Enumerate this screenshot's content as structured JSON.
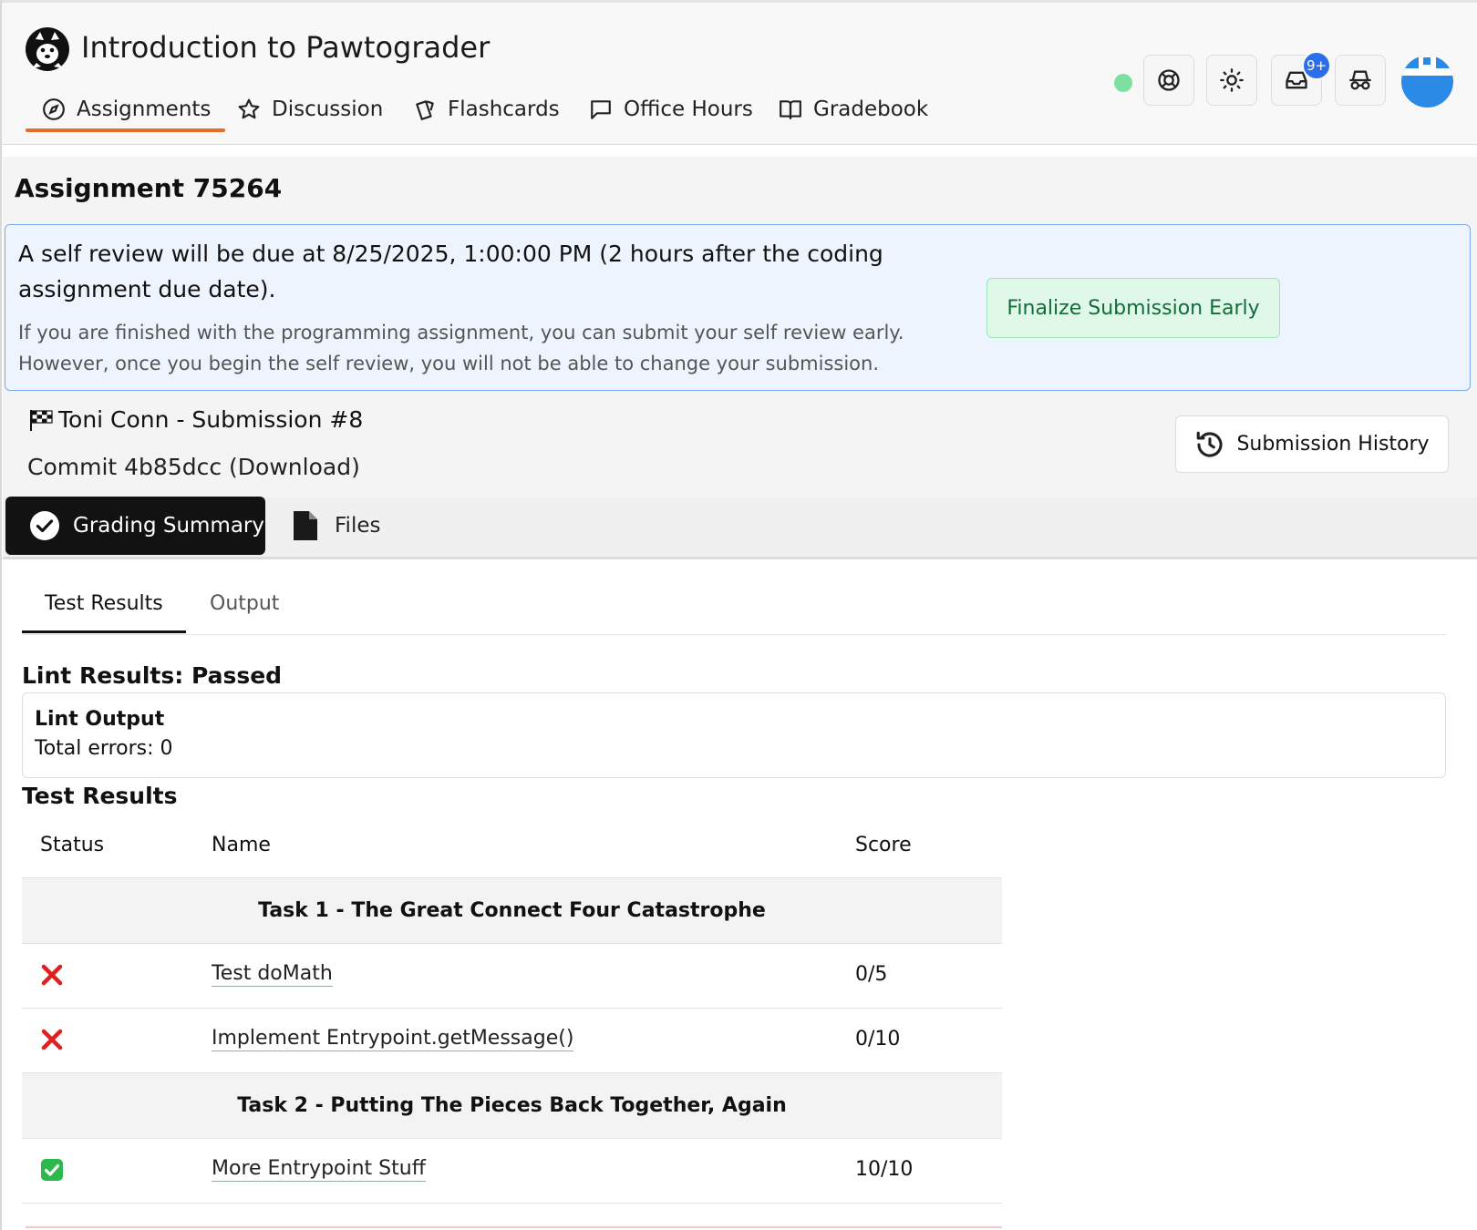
{
  "app": {
    "title": "Introduction to Pawtograder",
    "logo_icon": "husky-logo-icon"
  },
  "nav": {
    "tabs": [
      {
        "label": "Assignments",
        "icon": "compass-icon",
        "active": true
      },
      {
        "label": "Discussion",
        "icon": "star-icon",
        "active": false
      },
      {
        "label": "Flashcards",
        "icon": "cards-icon",
        "active": false
      },
      {
        "label": "Office Hours",
        "icon": "chat-bubble-icon",
        "active": false
      },
      {
        "label": "Gradebook",
        "icon": "open-book-icon",
        "active": false
      }
    ]
  },
  "header_actions": {
    "status_color": "#7ee0a0",
    "icons": [
      "help-lifebuoy-icon",
      "sun-theme-icon",
      "inbox-icon",
      "incognito-icon"
    ],
    "notification_badge": "9+"
  },
  "page": {
    "title": "Assignment 75264"
  },
  "alert": {
    "title": "A self review will be due at 8/25/2025, 1:00:00 PM (2 hours after the coding assignment due date).",
    "description": "If you are finished with the programming assignment, you can submit your self review early. However, once you begin the self review, you will not be able to change your submission.",
    "button_label": "Finalize Submission Early"
  },
  "submission": {
    "title": "Toni Conn - Submission #8",
    "commit": "Commit 4b85dcc (Download)",
    "history_button": "Submission History"
  },
  "main_tabs": [
    {
      "label": "Grading Summary",
      "icon": "check-circle-icon",
      "active": true
    },
    {
      "label": "Files",
      "icon": "file-icon",
      "active": false
    }
  ],
  "result_tabs": [
    {
      "label": "Test Results",
      "active": true
    },
    {
      "label": "Output",
      "active": false
    }
  ],
  "lint": {
    "heading": "Lint Results: Passed",
    "box_title": "Lint Output",
    "box_value": "Total errors: 0"
  },
  "tests": {
    "heading": "Test Results",
    "columns": {
      "status": "Status",
      "name": "Name",
      "score": "Score"
    },
    "groups": [
      {
        "title": "Task 1 - The Great Connect Four Catastrophe",
        "rows": [
          {
            "status": "fail",
            "name": "Test doMath",
            "score": "0/5"
          },
          {
            "status": "fail",
            "name": "Implement Entrypoint.getMessage()",
            "score": "0/10"
          }
        ]
      },
      {
        "title": "Task 2 - Putting The Pieces Back Together, Again",
        "rows": [
          {
            "status": "pass",
            "name": "More Entrypoint Stuff",
            "score": "10/10"
          }
        ]
      }
    ]
  },
  "colors": {
    "accent": "#ea6a2a",
    "alert_bg": "#eef4fe",
    "alert_border": "#7aa8ef",
    "success_bg": "#dff8e8",
    "success_text": "#146b3a",
    "fail": "#e02020",
    "pass": "#2cb84a",
    "badge": "#2b6fe8"
  }
}
